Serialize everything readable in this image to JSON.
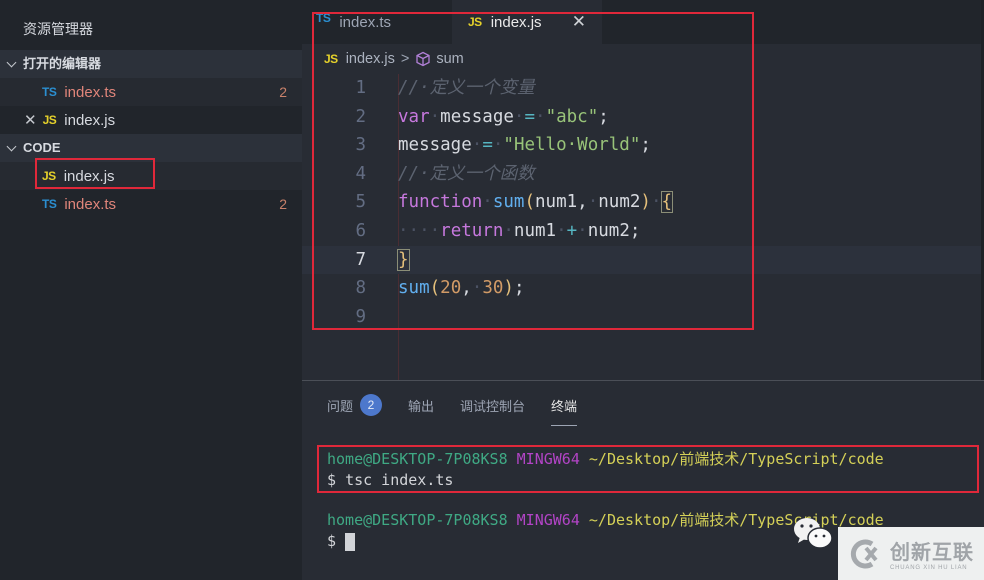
{
  "sidebar": {
    "title": "资源管理器",
    "open_editors": {
      "header": "打开的编辑器",
      "items": [
        {
          "icon": "TS",
          "name": "index.ts",
          "problems": "2",
          "state": "error"
        },
        {
          "icon": "JS",
          "name": "index.js",
          "problems": "",
          "state": "ok",
          "close": "✕"
        }
      ]
    },
    "workspace": {
      "header": "CODE",
      "items": [
        {
          "icon": "JS",
          "name": "index.js",
          "problems": "",
          "state": "ok"
        },
        {
          "icon": "TS",
          "name": "index.ts",
          "problems": "2",
          "state": "error"
        }
      ]
    }
  },
  "editor": {
    "tabs": [
      {
        "icon": "TS",
        "label": "index.ts",
        "active": false
      },
      {
        "icon": "JS",
        "label": "index.js",
        "active": true,
        "close": "✕"
      }
    ],
    "breadcrumb": {
      "file_icon": "JS",
      "file": "index.js",
      "separator": ">",
      "symbol": "sum"
    },
    "current_line": 7,
    "lines": [
      {
        "n": "1",
        "tokens": [
          [
            "c-com",
            "//·定义一个变量"
          ]
        ]
      },
      {
        "n": "2",
        "tokens": [
          [
            "c-kw",
            "var"
          ],
          [
            "c-dot",
            "·"
          ],
          [
            "c-var",
            "message"
          ],
          [
            "c-dot",
            "·"
          ],
          [
            "c-op",
            "="
          ],
          [
            "c-dot",
            "·"
          ],
          [
            "c-str",
            "\"abc\""
          ],
          [
            "c-plain",
            ";"
          ]
        ]
      },
      {
        "n": "3",
        "tokens": [
          [
            "c-var",
            "message"
          ],
          [
            "c-dot",
            "·"
          ],
          [
            "c-op",
            "="
          ],
          [
            "c-dot",
            "·"
          ],
          [
            "c-str",
            "\"Hello·World\""
          ],
          [
            "c-plain",
            ";"
          ]
        ]
      },
      {
        "n": "4",
        "tokens": [
          [
            "c-com",
            "//·定义一个函数"
          ]
        ]
      },
      {
        "n": "5",
        "tokens": [
          [
            "c-kw",
            "function"
          ],
          [
            "c-dot",
            "·"
          ],
          [
            "c-fn",
            "sum"
          ],
          [
            "c-br",
            "("
          ],
          [
            "c-var",
            "num1"
          ],
          [
            "c-plain",
            ","
          ],
          [
            "c-dot",
            "·"
          ],
          [
            "c-var",
            "num2"
          ],
          [
            "c-br",
            ")"
          ],
          [
            "c-dot",
            "·"
          ],
          [
            "c-br box",
            "{"
          ]
        ]
      },
      {
        "n": "6",
        "tokens": [
          [
            "c-dot",
            "····"
          ],
          [
            "c-kw",
            "return"
          ],
          [
            "c-dot",
            "·"
          ],
          [
            "c-var",
            "num1"
          ],
          [
            "c-dot",
            "·"
          ],
          [
            "c-op",
            "+"
          ],
          [
            "c-dot",
            "·"
          ],
          [
            "c-var",
            "num2"
          ],
          [
            "c-plain",
            ";"
          ]
        ]
      },
      {
        "n": "7",
        "tokens": [
          [
            "c-br box",
            "}"
          ]
        ]
      },
      {
        "n": "8",
        "tokens": [
          [
            "c-fn",
            "sum"
          ],
          [
            "c-br",
            "("
          ],
          [
            "c-num",
            "20"
          ],
          [
            "c-plain",
            ","
          ],
          [
            "c-dot",
            "·"
          ],
          [
            "c-num",
            "30"
          ],
          [
            "c-br",
            ")"
          ],
          [
            "c-plain",
            ";"
          ]
        ]
      },
      {
        "n": "9",
        "tokens": []
      }
    ]
  },
  "panel": {
    "tabs": [
      {
        "label": "问题",
        "badge": "2",
        "active": false
      },
      {
        "label": "输出",
        "active": false
      },
      {
        "label": "调试控制台",
        "active": false
      },
      {
        "label": "终端",
        "active": true
      }
    ],
    "terminal": {
      "blocks": [
        {
          "user": "home@DESKTOP-7P08KS8",
          "env": "MINGW64",
          "path": "~/Desktop/前端技术/TypeScript/code",
          "prompt": "$",
          "command": "tsc index.ts"
        },
        {
          "user": "home@DESKTOP-7P08KS8",
          "env": "MINGW64",
          "path": "~/Desktop/前端技术/TypeScript/code",
          "prompt": "$",
          "command": ""
        }
      ]
    }
  },
  "watermark": {
    "name_cn": "创新互联",
    "name_en": "CHUANG XIN HU LIAN"
  },
  "colors": {
    "highlight": "#e0283a",
    "ts_icon": "#2b8fd1",
    "js_icon": "#e5d12b",
    "error_file": "#e0857a",
    "badge": "#4d78cc"
  }
}
